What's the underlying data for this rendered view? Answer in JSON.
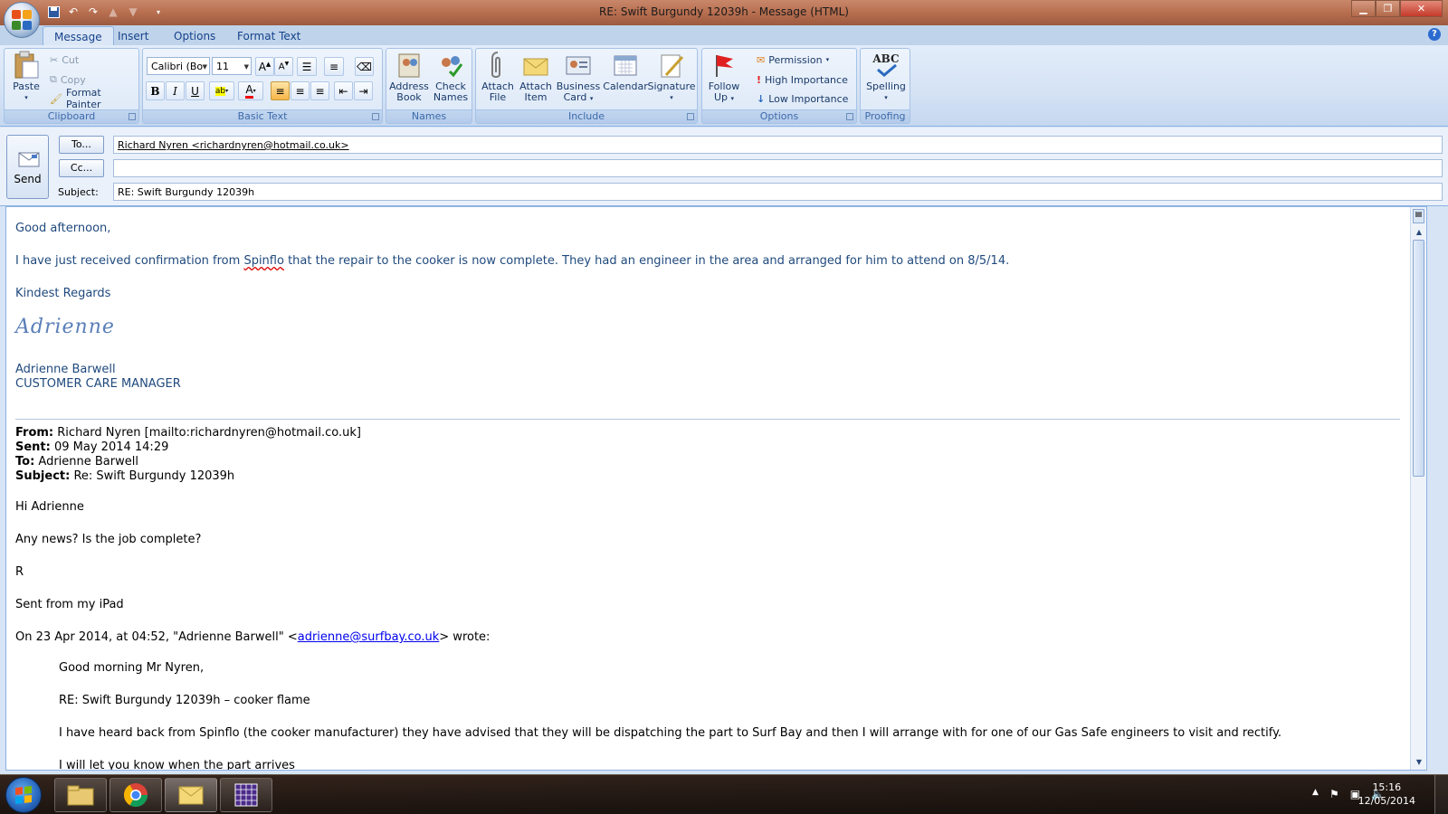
{
  "window": {
    "title": "RE: Swift Burgundy 12039h - Message (HTML)"
  },
  "ribbon": {
    "tabs": [
      "Message",
      "Insert",
      "Options",
      "Format Text"
    ],
    "clipboard": {
      "label": "Clipboard",
      "paste": "Paste",
      "cut": "Cut",
      "copy": "Copy",
      "format_painter": "Format Painter"
    },
    "basic_text": {
      "label": "Basic Text",
      "font": "Calibri (Bo",
      "size": "11"
    },
    "names": {
      "label": "Names",
      "address_book": [
        "Address",
        "Book"
      ],
      "check_names": [
        "Check",
        "Names"
      ]
    },
    "include": {
      "label": "Include",
      "attach_file": [
        "Attach",
        "File"
      ],
      "attach_item": [
        "Attach",
        "Item"
      ],
      "business_card": [
        "Business",
        "Card"
      ],
      "calendar": "Calendar",
      "signature": "Signature"
    },
    "options": {
      "label": "Options",
      "follow_up": [
        "Follow",
        "Up"
      ],
      "permission": "Permission",
      "high_importance": "High Importance",
      "low_importance": "Low Importance"
    },
    "proofing": {
      "label": "Proofing",
      "spelling": "Spelling",
      "spelling_icon": "ABC"
    }
  },
  "header": {
    "send": "Send",
    "to_button": "To...",
    "cc_button": "Cc...",
    "subject_label": "Subject:",
    "to_value": "Richard Nyren <richardnyren@hotmail.co.uk>",
    "cc_value": "",
    "subject_value": "RE: Swift Burgundy 12039h"
  },
  "message": {
    "greeting": "Good afternoon,",
    "line1_pre": "I have just received confirmation from ",
    "line1_word": "Spinflo",
    "line1_post": " that the repair to the cooker is now complete.  They had an engineer in the area and arranged for him to attend on 8/5/14.",
    "regards": "Kindest Regards",
    "signature_script": "Adrienne",
    "sig_name": "Adrienne Barwell",
    "sig_title": "CUSTOMER CARE MANAGER",
    "quoted": {
      "from_label": "From:",
      "from_value": " Richard Nyren [mailto:richardnyren@hotmail.co.uk]",
      "sent_label": "Sent:",
      "sent_value": " 09 May 2014 14:29",
      "to_label": "To:",
      "to_value": " Adrienne Barwell",
      "subject_label": "Subject:",
      "subject_value": " Re: Swift Burgundy 12039h",
      "hi": "Hi Adrienne",
      "question": "Any news? Is the job complete?",
      "initial": "R",
      "sent_from": "Sent from my iPad",
      "wrote_pre": "On 23 Apr 2014, at 04:52, \"Adrienne Barwell\" <",
      "wrote_email": "adrienne@surfbay.co.uk",
      "wrote_post": "> wrote:",
      "inner_greeting": "Good morning Mr Nyren,",
      "inner_re": "RE: Swift Burgundy 12039h – cooker flame",
      "inner_body": "I have heard back from Spinflo (the cooker manufacturer) they have advised that  they will be dispatching the part to Surf Bay and then I will arrange with for one of our Gas Safe engineers to visit and rectify.",
      "inner_cut": "I will let you know when the part arrives"
    }
  },
  "taskbar": {
    "time": "15:16",
    "date": "12/05/2014"
  },
  "colors": {
    "body_text": "#1f497d",
    "ribbon_label": "#3e6aaa",
    "link": "#0000ee"
  }
}
